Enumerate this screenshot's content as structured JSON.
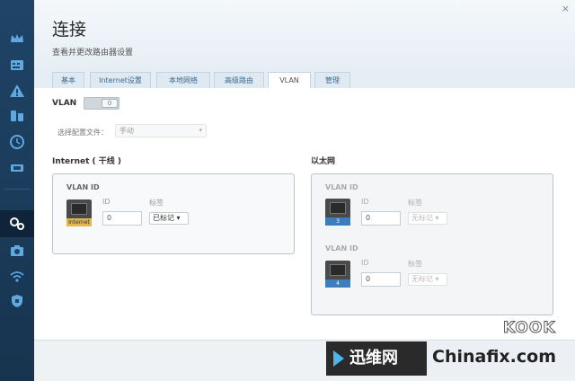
{
  "app": {
    "title": "连接",
    "subtitle": "查看并更改路由器设置",
    "close_glyph": "×"
  },
  "sidebar": {
    "icons": [
      "crown-icon",
      "network-map-icon",
      "warning-icon",
      "parental-icon",
      "clock-icon",
      "usb-icon",
      "gear-icon",
      "camera-icon",
      "wifi-icon",
      "shield-icon"
    ],
    "active": "gear-icon"
  },
  "tabs": [
    {
      "label": "基本"
    },
    {
      "label": "Internet设置"
    },
    {
      "label": "本地网络"
    },
    {
      "label": "高级路由"
    },
    {
      "label": "VLAN",
      "active": true
    },
    {
      "label": "管理"
    }
  ],
  "vlan": {
    "label": "VLAN",
    "toggle_text": "0",
    "profile_label": "选择配置文件：",
    "profile_value": "手动"
  },
  "internet": {
    "section_title": "Internet ( 干线 )",
    "box_head": "VLAN ID",
    "id_label": "ID",
    "tag_label": "标签",
    "port_plate": "Internet",
    "id_value": "0",
    "tag_value": "已标记"
  },
  "ethernet": {
    "section_title": "以太网",
    "ports": [
      {
        "box_head": "VLAN ID",
        "id_label": "ID",
        "tag_label": "标签",
        "plate": "3",
        "id_value": "0",
        "tag_value": "无标记"
      },
      {
        "box_head": "VLAN ID",
        "id_label": "ID",
        "tag_label": "标签",
        "plate": "4",
        "id_value": "0",
        "tag_value": "无标记"
      }
    ]
  },
  "watermark": {
    "brand": "迅维网",
    "site": "Chinafix.com",
    "corner": "KOOK"
  },
  "colors": {
    "sidebar": "#1f4467",
    "tab_text": "#3b6a90",
    "internet_plate": "#e6b84a",
    "lan_plate": "#3c7dbd"
  }
}
